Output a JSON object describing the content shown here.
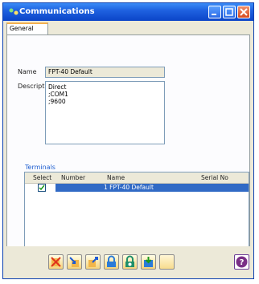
{
  "window": {
    "title": "Communications"
  },
  "tabs": [
    {
      "label": "General"
    }
  ],
  "form": {
    "name_label": "Name",
    "name_value": "FPT-40 Default",
    "description_label": "Description",
    "description_value": "Direct\n;COM1\n;9600"
  },
  "terminals": {
    "caption": "Terminals",
    "columns": [
      "Select",
      "Number",
      "Name",
      "Serial No"
    ],
    "rows": [
      {
        "selected": true,
        "number": "",
        "name": "1 FPT-40 Default",
        "serial": ""
      }
    ]
  },
  "toolbar": {
    "buttons": [
      "delete-icon",
      "import-icon",
      "export-icon",
      "lock-icon",
      "settings-lock-icon",
      "save-icon",
      "blank-icon",
      "help-icon"
    ]
  }
}
